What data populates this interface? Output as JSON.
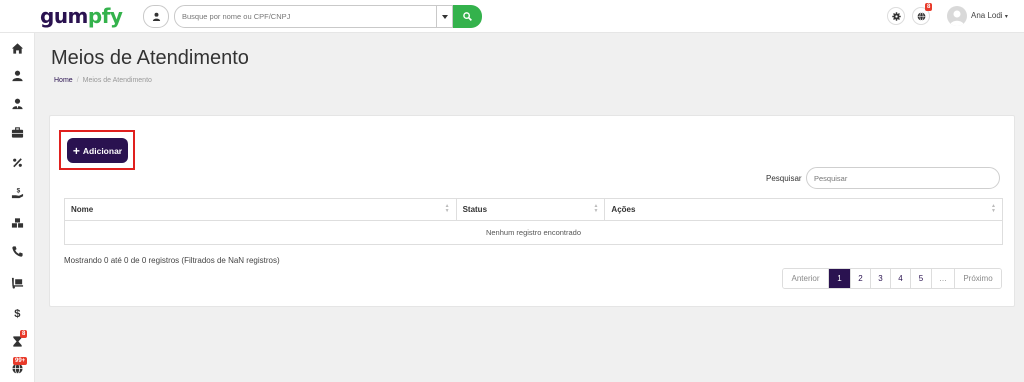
{
  "brand": {
    "part1": "gum",
    "part2": "pfy"
  },
  "colors": {
    "primary": "#2a1250",
    "accent": "#34b24c",
    "badge": "#e83a2a",
    "highlight": "#e0201e"
  },
  "topbar": {
    "search_placeholder": "Busque por nome ou CPF/CNPJ",
    "globe_badge": "8",
    "user_name": "Ana Lodi",
    "user_caret": "▾"
  },
  "sidebar": {
    "items": [
      {
        "icon": "home-icon"
      },
      {
        "icon": "user-icon"
      },
      {
        "icon": "user-tie-icon"
      },
      {
        "icon": "briefcase-icon"
      },
      {
        "icon": "percent-icon"
      },
      {
        "icon": "hand-holding-dollar-icon"
      },
      {
        "icon": "boxes-icon"
      },
      {
        "icon": "phone-icon"
      },
      {
        "icon": "dolly-icon"
      },
      {
        "icon": "dollar-icon"
      },
      {
        "icon": "hourglass-icon",
        "badge": "8"
      },
      {
        "icon": "globe-icon",
        "badge": "99+"
      }
    ]
  },
  "page": {
    "title": "Meios de Atendimento",
    "breadcrumb": {
      "home": "Home",
      "separator": "/",
      "current": "Meios de Atendimento"
    }
  },
  "toolbar": {
    "add_label": "Adicionar"
  },
  "table_search": {
    "label": "Pesquisar",
    "placeholder": "Pesquisar"
  },
  "table": {
    "columns": [
      "Nome",
      "Status",
      "Ações"
    ],
    "empty_message": "Nenhum registro encontrado"
  },
  "info_text": "Mostrando 0 até 0 de 0 registros (Filtrados de NaN registros)",
  "pagination": {
    "previous": "Anterior",
    "pages": [
      "1",
      "2",
      "3",
      "4",
      "5"
    ],
    "ellipsis": "…",
    "next": "Próximo",
    "current": "1"
  }
}
